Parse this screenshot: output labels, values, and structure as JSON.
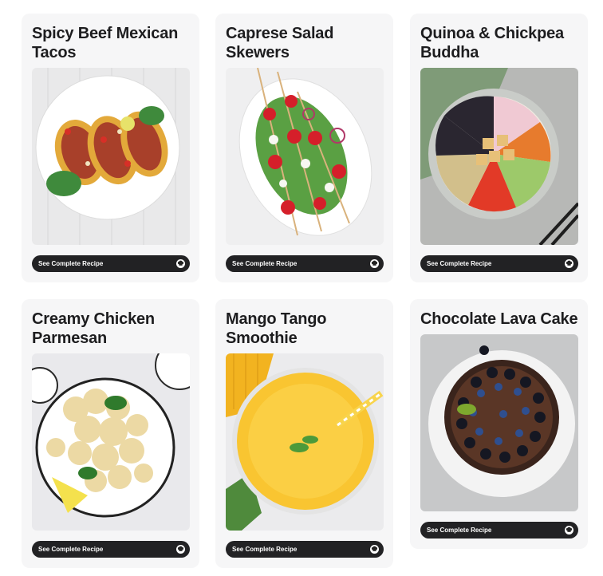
{
  "recipes": [
    {
      "title": "Spicy Beef Mexican Tacos",
      "button_label": "See Complete Recipe",
      "button_icon": "chef-hat-icon",
      "image_subject": "tacos-photo"
    },
    {
      "title": "Caprese Salad Skewers",
      "button_label": "See Complete Recipe",
      "button_icon": "chef-hat-icon",
      "image_subject": "caprese-skewers-photo"
    },
    {
      "title": "Quinoa & Chickpea Buddha",
      "button_label": "See Complete Recipe",
      "button_icon": "chef-hat-icon",
      "image_subject": "buddha-bowl-photo"
    },
    {
      "title": "Creamy Chicken Parmesan",
      "button_label": "See Complete Recipe",
      "button_icon": "chef-hat-icon",
      "image_subject": "cauliflower-plate-photo"
    },
    {
      "title": "Mango Tango Smoothie",
      "button_label": "See Complete Recipe",
      "button_icon": "chef-hat-icon",
      "image_subject": "mango-smoothie-photo"
    },
    {
      "title": "Chocolate Lava Cake",
      "button_label": "See Complete Recipe",
      "button_icon": "chef-hat-icon",
      "image_subject": "chocolate-cake-photo"
    }
  ],
  "colors": {
    "page_background": "#ffffff",
    "card_background": "#f6f6f7",
    "title_text": "#1d1d1f",
    "button_background": "#222224",
    "button_text": "#ffffff"
  }
}
